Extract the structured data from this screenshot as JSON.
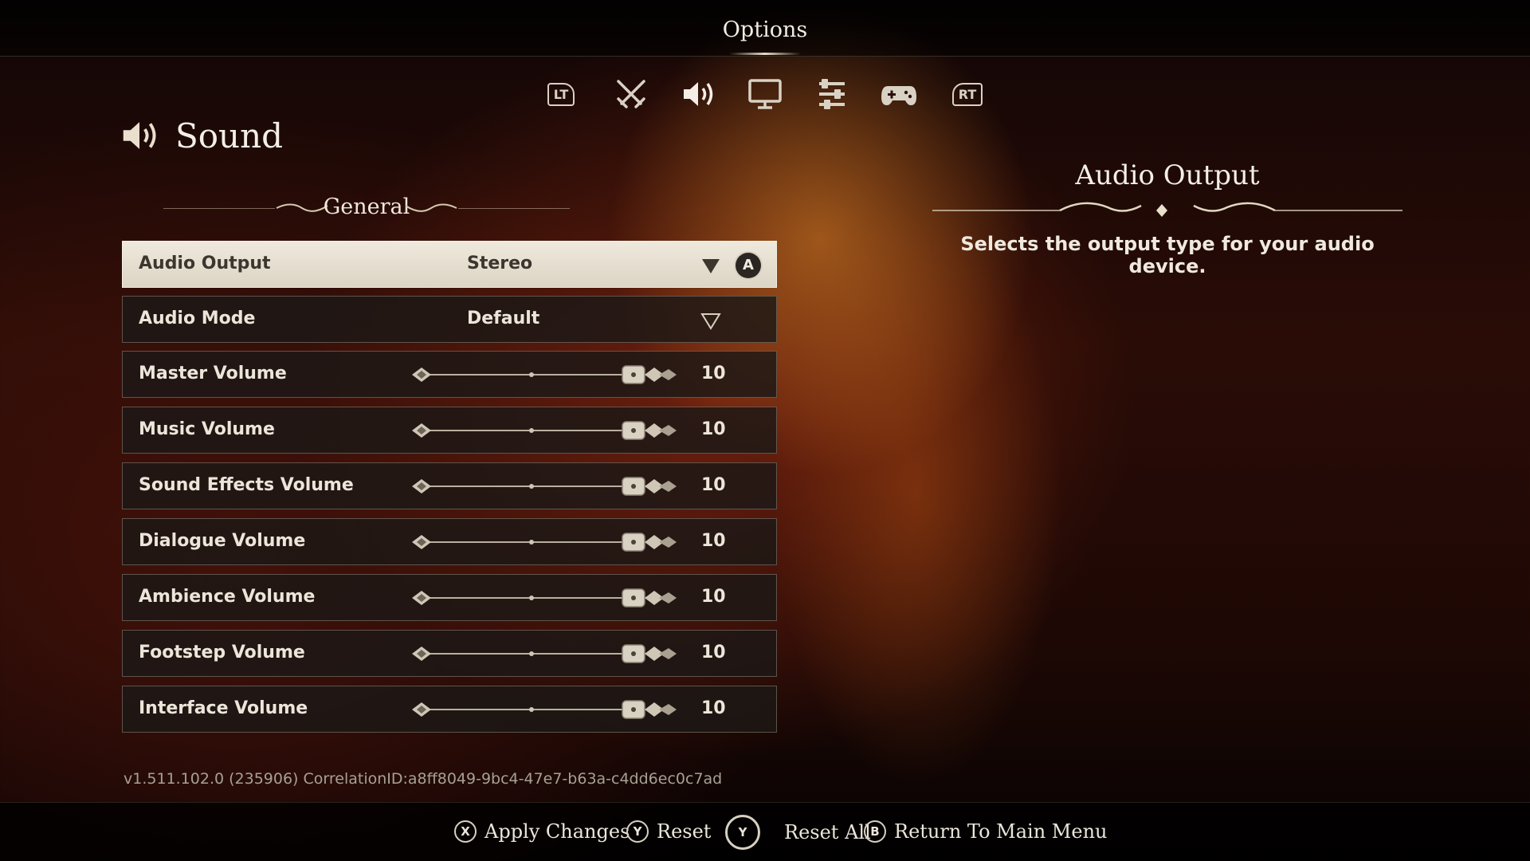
{
  "header": {
    "title": "Options"
  },
  "tabs": [
    {
      "name": "lt-bumper",
      "label": "LT"
    },
    {
      "name": "gameplay-icon"
    },
    {
      "name": "sound-icon",
      "active": true
    },
    {
      "name": "display-icon"
    },
    {
      "name": "settings-sliders-icon"
    },
    {
      "name": "controller-icon"
    },
    {
      "name": "rt-bumper",
      "label": "RT"
    }
  ],
  "section": {
    "title": "Sound",
    "icon": "speaker-icon"
  },
  "group": {
    "title": "General"
  },
  "settings": [
    {
      "label": "Audio Output",
      "type": "dropdown",
      "value": "Stereo",
      "selected": true,
      "confirm_button": "A"
    },
    {
      "label": "Audio Mode",
      "type": "dropdown",
      "value": "Default"
    },
    {
      "label": "Master Volume",
      "type": "slider",
      "value": "10",
      "level": 1.0
    },
    {
      "label": "Music Volume",
      "type": "slider",
      "value": "10",
      "level": 1.0
    },
    {
      "label": "Sound Effects Volume",
      "type": "slider",
      "value": "10",
      "level": 1.0
    },
    {
      "label": "Dialogue Volume",
      "type": "slider",
      "value": "10",
      "level": 1.0
    },
    {
      "label": "Ambience Volume",
      "type": "slider",
      "value": "10",
      "level": 1.0
    },
    {
      "label": "Footstep Volume",
      "type": "slider",
      "value": "10",
      "level": 1.0
    },
    {
      "label": "Interface Volume",
      "type": "slider",
      "value": "10",
      "level": 1.0
    }
  ],
  "info": {
    "title": "Audio Output",
    "description": "Selects the output type for your audio device."
  },
  "version": "v1.511.102.0 (235906) CorrelationID:a8ff8049-9bc4-47e7-b63a-c4dd6ec0c7ad",
  "footer": {
    "apply": {
      "button": "X",
      "label": "Apply Changes"
    },
    "reset": {
      "button": "Y",
      "label": "Reset"
    },
    "reset_all": {
      "button": "Y",
      "label": "Reset All"
    },
    "back": {
      "button": "B",
      "label": "Return To Main Menu"
    }
  }
}
